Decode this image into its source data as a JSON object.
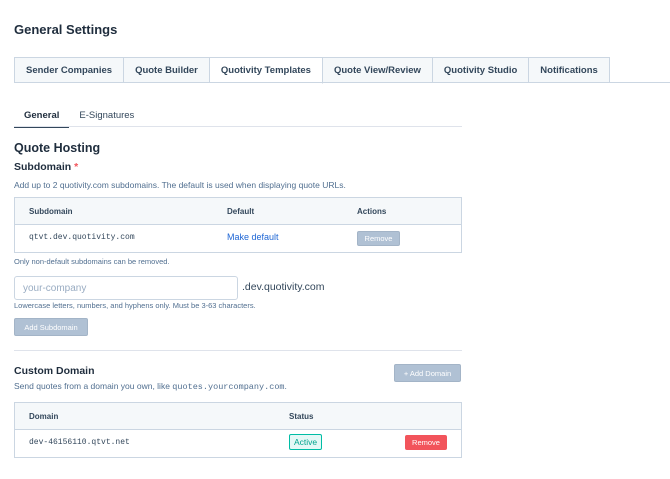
{
  "page": {
    "title": "General Settings"
  },
  "tabs": [
    {
      "label": "Sender Companies",
      "active": false
    },
    {
      "label": "Quote Builder",
      "active": false
    },
    {
      "label": "Quotivity Templates",
      "active": true
    },
    {
      "label": "Quote View/Review",
      "active": false
    },
    {
      "label": "Quotivity Studio",
      "active": false
    },
    {
      "label": "Notifications",
      "active": false
    }
  ],
  "subtabs": [
    {
      "label": "General",
      "active": true
    },
    {
      "label": "E-Signatures",
      "active": false
    }
  ],
  "hosting": {
    "title": "Quote Hosting",
    "subdomain_label": "Subdomain",
    "required_mark": "*",
    "subdomain_help": "Add up to 2 quotivity.com subdomains. The default is used when displaying quote URLs.",
    "table": {
      "headers": {
        "subdomain": "Subdomain",
        "default": "Default",
        "actions": "Actions"
      },
      "rows": [
        {
          "subdomain": "qtvt.dev.quotivity.com",
          "default_action": "Make default",
          "remove_label": "Remove"
        }
      ]
    },
    "remove_note": "Only non-default subdomains can be removed.",
    "input_placeholder": "your-company",
    "input_suffix": ".dev.quotivity.com",
    "input_help": "Lowercase letters, numbers, and hyphens only. Must be 3-63 characters.",
    "add_button": "Add Subdomain"
  },
  "custom_domain": {
    "title": "Custom Domain",
    "help_prefix": "Send quotes from a domain you own, like ",
    "help_code": "quotes.yourcompany.com",
    "help_suffix": ".",
    "add_button": "+ Add Domain",
    "table": {
      "headers": {
        "domain": "Domain",
        "status": "Status"
      },
      "rows": [
        {
          "domain": "dev-46156110.qtvt.net",
          "status": "Active",
          "remove_label": "Remove"
        }
      ]
    }
  },
  "colors": {
    "accent_link": "#1e66d5",
    "danger": "#f2545b",
    "success": "#00bda5",
    "muted_button": "#b0c1d4"
  }
}
